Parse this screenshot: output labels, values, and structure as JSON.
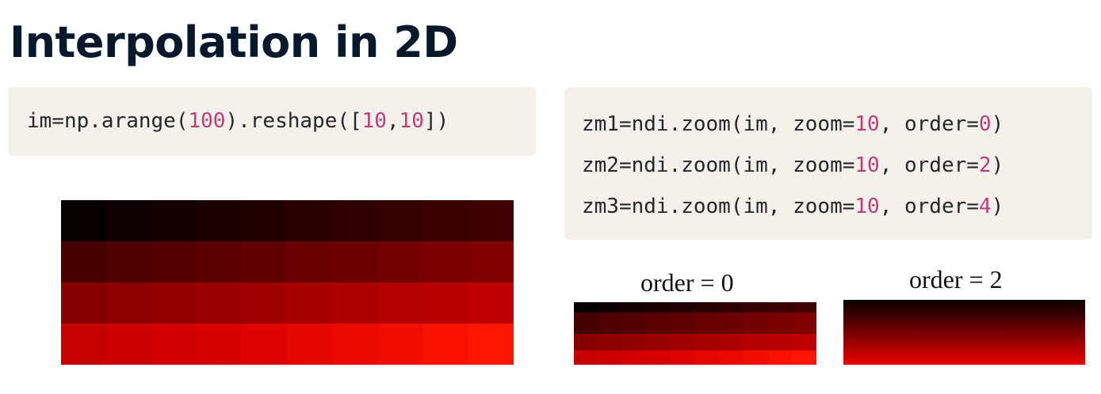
{
  "slide": {
    "title": "Interpolation in 2D"
  },
  "code_left": {
    "lines": [
      [
        {
          "t": "im=np.arange(",
          "k": "text"
        },
        {
          "t": "100",
          "k": "num"
        },
        {
          "t": ").reshape([",
          "k": "text"
        },
        {
          "t": "10",
          "k": "num"
        },
        {
          "t": ",",
          "k": "text"
        },
        {
          "t": "10",
          "k": "num"
        },
        {
          "t": "])",
          "k": "text"
        }
      ]
    ]
  },
  "code_right": {
    "lines": [
      [
        {
          "t": "zm1=ndi.zoom(im, zoom=",
          "k": "text"
        },
        {
          "t": "10",
          "k": "num"
        },
        {
          "t": ", order=",
          "k": "text"
        },
        {
          "t": "0",
          "k": "num"
        },
        {
          "t": ")",
          "k": "text"
        }
      ],
      [
        {
          "t": "zm2=ndi.zoom(im, zoom=",
          "k": "text"
        },
        {
          "t": "10",
          "k": "num"
        },
        {
          "t": ", order=",
          "k": "text"
        },
        {
          "t": "2",
          "k": "num"
        },
        {
          "t": ")",
          "k": "text"
        }
      ],
      [
        {
          "t": "zm3=ndi.zoom(im, zoom=",
          "k": "text"
        },
        {
          "t": "10",
          "k": "num"
        },
        {
          "t": ", order=",
          "k": "text"
        },
        {
          "t": "4",
          "k": "num"
        },
        {
          "t": ")",
          "k": "text"
        }
      ]
    ]
  },
  "images": {
    "order0_label": "order = 0",
    "order2_label": "order = 2"
  },
  "chart_data": [
    {
      "type": "heatmap",
      "colormap": "black-red",
      "rows": [
        [
          0,
          1,
          2,
          3,
          4,
          5,
          6,
          7,
          8,
          9
        ],
        [
          10,
          11,
          12,
          13,
          14,
          15,
          16,
          17,
          18,
          19
        ],
        [
          20,
          21,
          22,
          23,
          24,
          25,
          26,
          27,
          28,
          29
        ],
        [
          30,
          31,
          32,
          33,
          34,
          35,
          36,
          37,
          38,
          39
        ]
      ],
      "vmin": 0,
      "vmax": 39
    },
    {
      "type": "heatmap",
      "colormap": "black-red",
      "title": "order = 0",
      "rows": [
        [
          0,
          1,
          2,
          3,
          4,
          5,
          6,
          7,
          8,
          9
        ],
        [
          10,
          11,
          12,
          13,
          14,
          15,
          16,
          17,
          18,
          19
        ],
        [
          20,
          21,
          22,
          23,
          24,
          25,
          26,
          27,
          28,
          29
        ],
        [
          30,
          31,
          32,
          33,
          34,
          35,
          36,
          37,
          38,
          39
        ]
      ],
      "row_weights": [
        1,
        2,
        1.6,
        1.4
      ],
      "vmin": 0,
      "vmax": 39
    },
    {
      "type": "heatmap",
      "colormap": "black-red",
      "title": "order = 2",
      "smooth": true
    }
  ],
  "colors": {
    "title": "#05192d",
    "code_bg": "#f4f1eb",
    "code_text": "#23262a",
    "code_number": "#c23a78"
  }
}
